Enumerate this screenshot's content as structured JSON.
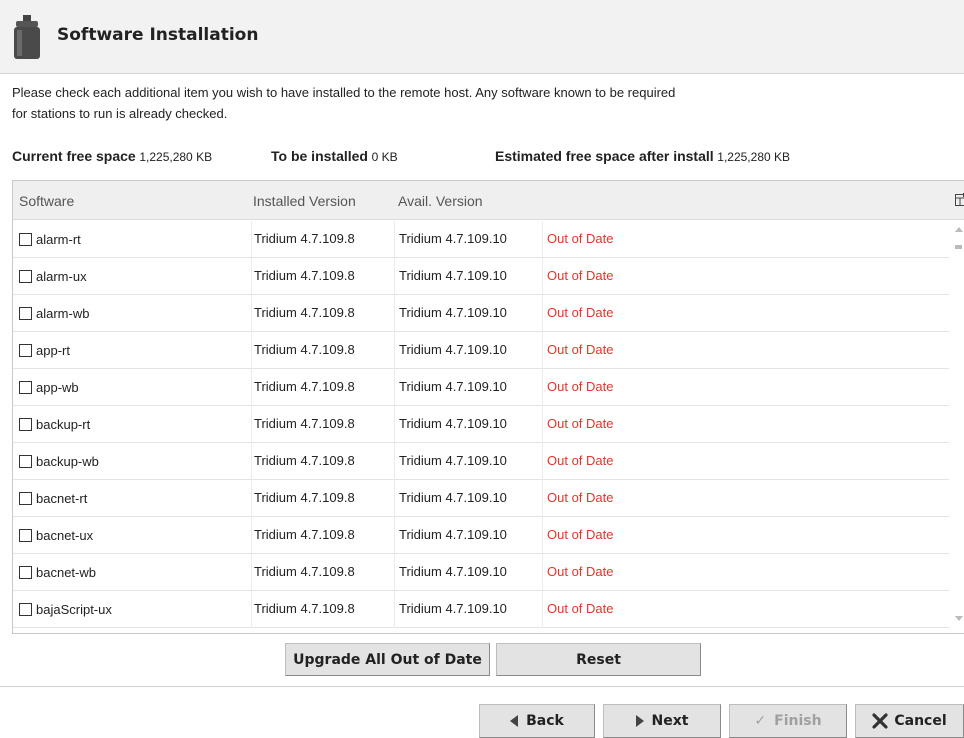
{
  "header": {
    "title": "Software Installation",
    "icon": "software-package-icon"
  },
  "intro": {
    "line1": "Please check each additional item you wish to have installed to the remote host. Any software known to be required",
    "line2": "for stations to run is already checked."
  },
  "space": {
    "current_label": "Current free space",
    "current_value": "1,225,280 KB",
    "to_install_label": "To be installed",
    "to_install_value": "0 KB",
    "estimated_label": "Estimated free space after install",
    "estimated_value": "1,225,280 KB"
  },
  "table": {
    "columns": [
      "Software",
      "Installed Version",
      "Avail. Version",
      ""
    ],
    "rows": [
      {
        "name": "alarm-rt",
        "installed": "Tridium 4.7.109.8",
        "available": "Tridium 4.7.109.10",
        "status": "Out of Date",
        "checked": false
      },
      {
        "name": "alarm-ux",
        "installed": "Tridium 4.7.109.8",
        "available": "Tridium 4.7.109.10",
        "status": "Out of Date",
        "checked": false
      },
      {
        "name": "alarm-wb",
        "installed": "Tridium 4.7.109.8",
        "available": "Tridium 4.7.109.10",
        "status": "Out of Date",
        "checked": false
      },
      {
        "name": "app-rt",
        "installed": "Tridium 4.7.109.8",
        "available": "Tridium 4.7.109.10",
        "status": "Out of Date",
        "checked": false
      },
      {
        "name": "app-wb",
        "installed": "Tridium 4.7.109.8",
        "available": "Tridium 4.7.109.10",
        "status": "Out of Date",
        "checked": false
      },
      {
        "name": "backup-rt",
        "installed": "Tridium 4.7.109.8",
        "available": "Tridium 4.7.109.10",
        "status": "Out of Date",
        "checked": false
      },
      {
        "name": "backup-wb",
        "installed": "Tridium 4.7.109.8",
        "available": "Tridium 4.7.109.10",
        "status": "Out of Date",
        "checked": false
      },
      {
        "name": "bacnet-rt",
        "installed": "Tridium 4.7.109.8",
        "available": "Tridium 4.7.109.10",
        "status": "Out of Date",
        "checked": false
      },
      {
        "name": "bacnet-ux",
        "installed": "Tridium 4.7.109.8",
        "available": "Tridium 4.7.109.10",
        "status": "Out of Date",
        "checked": false
      },
      {
        "name": "bacnet-wb",
        "installed": "Tridium 4.7.109.8",
        "available": "Tridium 4.7.109.10",
        "status": "Out of Date",
        "checked": false
      },
      {
        "name": "bajaScript-ux",
        "installed": "Tridium 4.7.109.8",
        "available": "Tridium 4.7.109.10",
        "status": "Out of Date",
        "checked": false
      }
    ]
  },
  "actions": {
    "upgrade_all": "Upgrade All Out of Date",
    "reset": "Reset"
  },
  "wizard": {
    "back": "Back",
    "next": "Next",
    "finish": "Finish",
    "cancel": "Cancel"
  },
  "colors": {
    "status_out_of_date": "#e8332a",
    "header_bg": "#f2f2f2",
    "button_bg": "#e3e3e3"
  }
}
